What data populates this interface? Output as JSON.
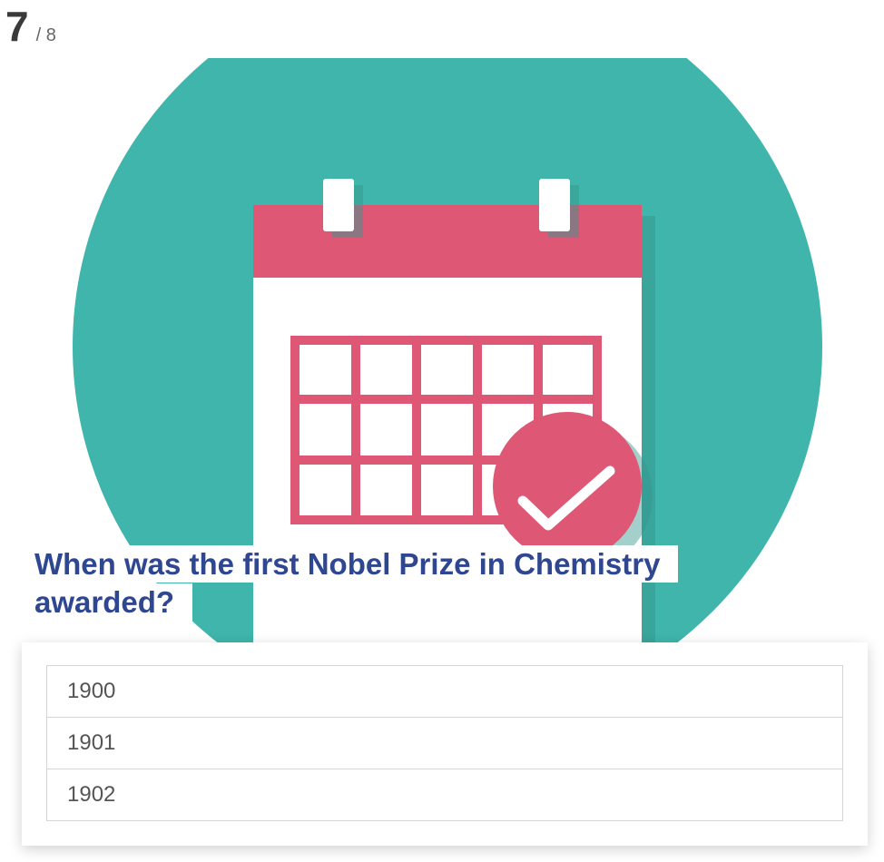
{
  "progress": {
    "current": "7",
    "total_text": "/ 8"
  },
  "hero": {
    "icon": "calendar-check-icon",
    "colors": {
      "background_circle": "#3fb5ab",
      "calendar_header": "#de5774",
      "calendar_body": "#ffffff",
      "check_badge": "#de5774"
    }
  },
  "question": {
    "text": "When was the first Nobel Prize in Chemistry awarded?",
    "color": "#2f4690"
  },
  "answers": [
    {
      "label": "1900"
    },
    {
      "label": "1901"
    },
    {
      "label": "1902"
    }
  ]
}
